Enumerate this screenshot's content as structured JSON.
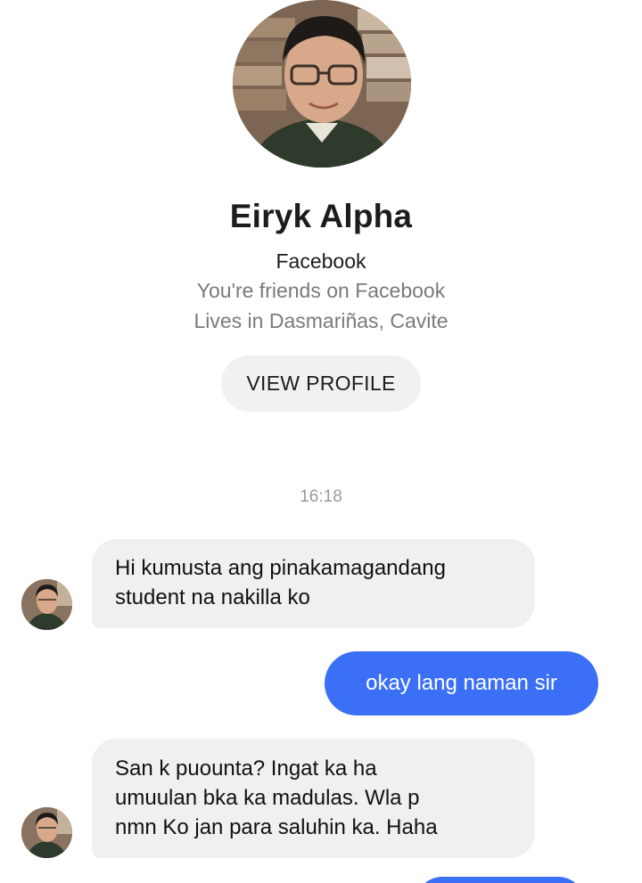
{
  "profile": {
    "name": "Eiryk Alpha",
    "source": "Facebook",
    "friends_text": "You're friends on Facebook",
    "location_text": "Lives in Dasmariñas, Cavite",
    "view_profile_label": "VIEW PROFILE"
  },
  "conversation": {
    "timestamp": "16:18",
    "messages": [
      {
        "direction": "incoming",
        "lines": [
          "Hi kumusta ang pinakamagandang",
          "student na nakilla ko"
        ]
      },
      {
        "direction": "outgoing",
        "text": "okay lang naman sir"
      },
      {
        "direction": "incoming",
        "lines": [
          "San k puounta? Ingat ka ha",
          "umuulan bka ka madulas. Wla p",
          "nmn Ko jan para saluhin ka. Haha"
        ]
      }
    ]
  },
  "colors": {
    "outgoing_bubble": "#3b6ff5",
    "incoming_bubble": "#f0f0f0",
    "view_profile_button": "#f1f1f1"
  }
}
